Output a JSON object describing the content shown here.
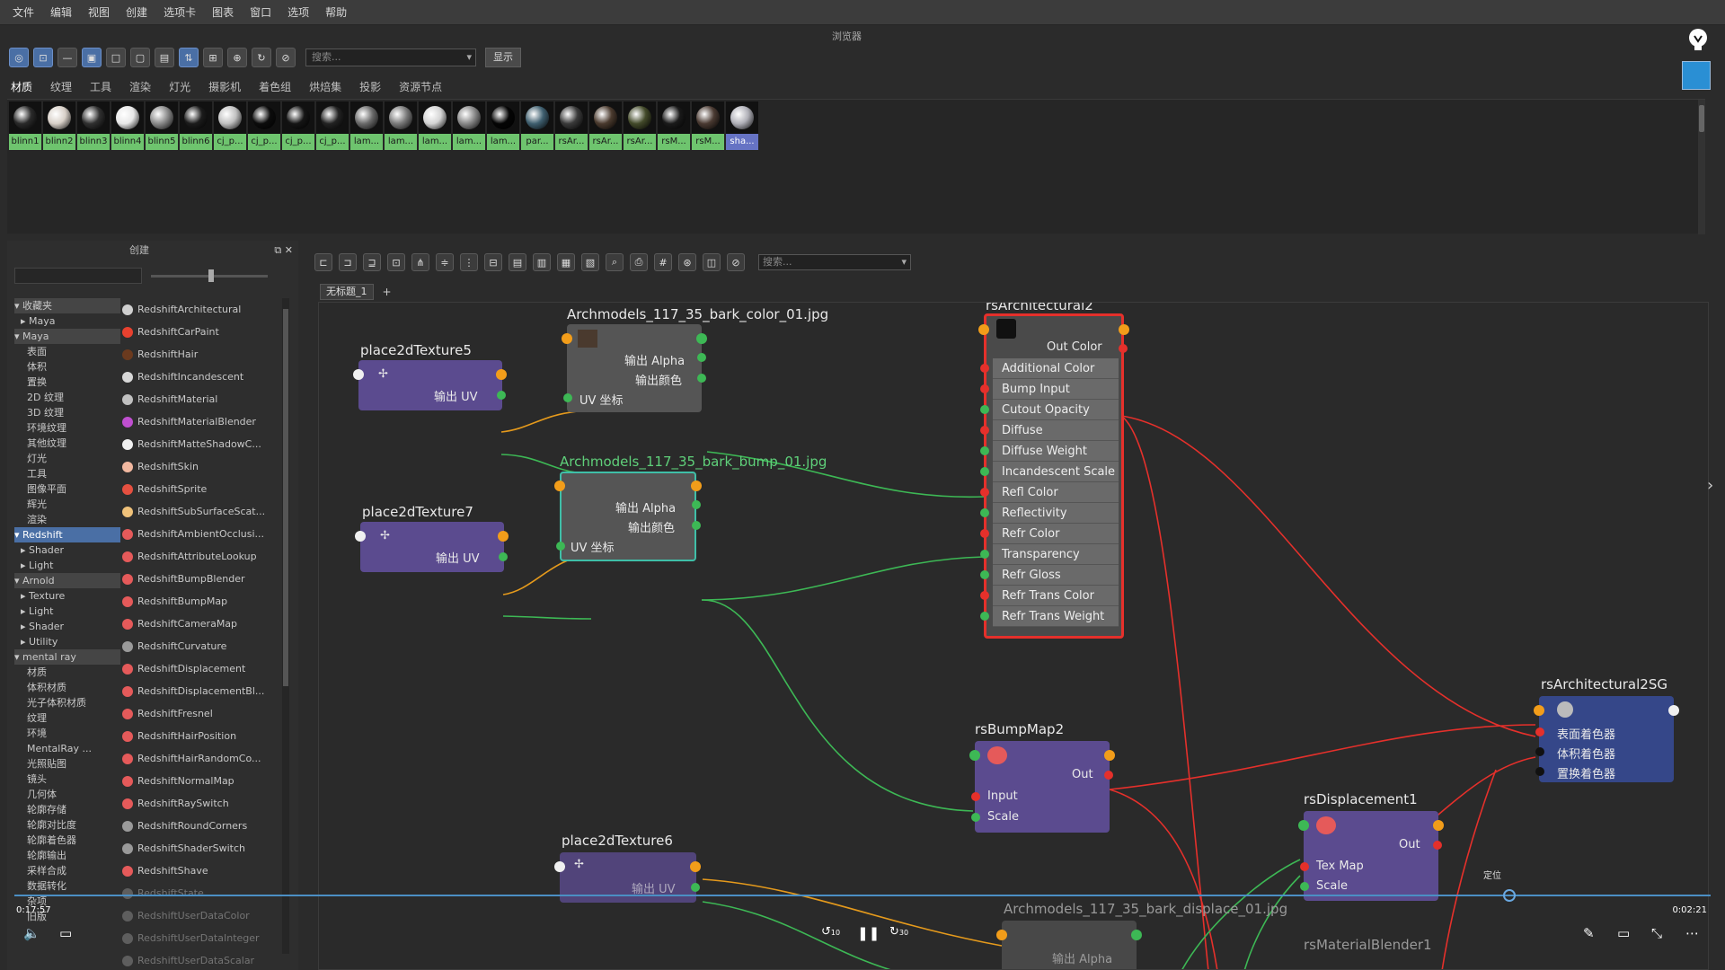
{
  "menu": [
    "文件",
    "编辑",
    "视图",
    "创建",
    "选项卡",
    "图表",
    "窗口",
    "选项",
    "帮助"
  ],
  "panel_title": "浏览器",
  "toolbar": {
    "search_placeholder": "搜索...",
    "show_label": "显示"
  },
  "category_tabs": [
    "材质",
    "纹理",
    "工具",
    "渲染",
    "灯光",
    "摄影机",
    "着色组",
    "烘焙集",
    "投影",
    "资源节点"
  ],
  "swatches": [
    {
      "label": "blinn1",
      "tone": "#2a2a2a"
    },
    {
      "label": "blinn2",
      "tone": "#d8d0c8"
    },
    {
      "label": "blinn3",
      "tone": "#303030"
    },
    {
      "label": "blinn4",
      "tone": "#e8e8e8"
    },
    {
      "label": "blinn5",
      "tone": "#8a8a8a"
    },
    {
      "label": "blinn6",
      "tone": "#1c1c1c"
    },
    {
      "label": "cj_p...",
      "tone": "#c0c0c0"
    },
    {
      "label": "cj_p...",
      "tone": "#0c0c0c"
    },
    {
      "label": "cj_p...",
      "tone": "#151515"
    },
    {
      "label": "cj_p...",
      "tone": "#222222"
    },
    {
      "label": "lam...",
      "tone": "#6a6a6a"
    },
    {
      "label": "lam...",
      "tone": "#7a7a7a"
    },
    {
      "label": "lam...",
      "tone": "#d4d4d4"
    },
    {
      "label": "lam...",
      "tone": "#888888"
    },
    {
      "label": "lam...",
      "tone": "#050505"
    },
    {
      "label": "par...",
      "tone": "#3f5f6f"
    },
    {
      "label": "rsAr...",
      "tone": "#3a3a3a"
    },
    {
      "label": "rsAr...",
      "tone": "#4a3a2e"
    },
    {
      "label": "rsAr...",
      "tone": "#434a2a"
    },
    {
      "label": "rsM...",
      "tone": "#1a1a1a"
    },
    {
      "label": "rsM...",
      "tone": "#4a3a32"
    },
    {
      "label": "sha...",
      "tone": "#b0b0b8"
    }
  ],
  "create_panel": {
    "title": "创建",
    "tree": [
      {
        "label": "▾ 收藏夹",
        "type": "head"
      },
      {
        "label": "  ▸ Maya",
        "type": "item"
      },
      {
        "label": "▾ Maya",
        "type": "head"
      },
      {
        "label": "    表面",
        "type": "item"
      },
      {
        "label": "    体积",
        "type": "item"
      },
      {
        "label": "    置换",
        "type": "item"
      },
      {
        "label": "    2D 纹理",
        "type": "item"
      },
      {
        "label": "    3D 纹理",
        "type": "item"
      },
      {
        "label": "    环境纹理",
        "type": "item"
      },
      {
        "label": "    其他纹理",
        "type": "item"
      },
      {
        "label": "    灯光",
        "type": "item"
      },
      {
        "label": "    工具",
        "type": "item"
      },
      {
        "label": "    图像平面",
        "type": "item"
      },
      {
        "label": "    辉光",
        "type": "item"
      },
      {
        "label": "    渲染",
        "type": "item"
      },
      {
        "label": "▾ Redshift",
        "type": "hl"
      },
      {
        "label": "  ▸ Shader",
        "type": "item"
      },
      {
        "label": "  ▸ Light",
        "type": "item"
      },
      {
        "label": "▾ Arnold",
        "type": "head"
      },
      {
        "label": "  ▸ Texture",
        "type": "item"
      },
      {
        "label": "  ▸ Light",
        "type": "item"
      },
      {
        "label": "  ▸ Shader",
        "type": "item"
      },
      {
        "label": "  ▸ Utility",
        "type": "item"
      },
      {
        "label": "▾ mental ray",
        "type": "head"
      },
      {
        "label": "    材质",
        "type": "item"
      },
      {
        "label": "    体积材质",
        "type": "item"
      },
      {
        "label": "    光子体积材质",
        "type": "item"
      },
      {
        "label": "    纹理",
        "type": "item"
      },
      {
        "label": "    环境",
        "type": "item"
      },
      {
        "label": "    MentalRay ...",
        "type": "item"
      },
      {
        "label": "    光照贴图",
        "type": "item"
      },
      {
        "label": "    镜头",
        "type": "item"
      },
      {
        "label": "    几何体",
        "type": "item"
      },
      {
        "label": "    轮廓存储",
        "type": "item"
      },
      {
        "label": "    轮廓对比度",
        "type": "item"
      },
      {
        "label": "    轮廓着色器",
        "type": "item"
      },
      {
        "label": "    轮廓输出",
        "type": "item"
      },
      {
        "label": "    采样合成",
        "type": "item"
      },
      {
        "label": "    数据转化",
        "type": "item"
      },
      {
        "label": "    杂项",
        "type": "item"
      },
      {
        "label": "    旧版",
        "type": "item"
      }
    ],
    "nodes": [
      {
        "label": "RedshiftArchitectural",
        "color": "#cfcfcf"
      },
      {
        "label": "RedshiftCarPaint",
        "color": "#e8412f"
      },
      {
        "label": "RedshiftHair",
        "color": "#6b3a1e"
      },
      {
        "label": "RedshiftIncandescent",
        "color": "#d8d8d8"
      },
      {
        "label": "RedshiftMaterial",
        "color": "#c0c0c0"
      },
      {
        "label": "RedshiftMaterialBlender",
        "color": "#c04fd0"
      },
      {
        "label": "RedshiftMatteShadowC...",
        "color": "#f0f0f0"
      },
      {
        "label": "RedshiftSkin",
        "color": "#f2b8a0"
      },
      {
        "label": "RedshiftSprite",
        "color": "#e55040"
      },
      {
        "label": "RedshiftSubSurfaceScat...",
        "color": "#f0c27a"
      },
      {
        "label": "RedshiftAmbientOcclusi...",
        "color": "#e55a5a"
      },
      {
        "label": "RedshiftAttributeLookup",
        "color": "#e55a5a"
      },
      {
        "label": "RedshiftBumpBlender",
        "color": "#e55a5a"
      },
      {
        "label": "RedshiftBumpMap",
        "color": "#e55a5a"
      },
      {
        "label": "RedshiftCameraMap",
        "color": "#e55a5a"
      },
      {
        "label": "RedshiftCurvature",
        "color": "#9a9a9a"
      },
      {
        "label": "RedshiftDisplacement",
        "color": "#e55a5a"
      },
      {
        "label": "RedshiftDisplacementBl...",
        "color": "#e55a5a"
      },
      {
        "label": "RedshiftFresnel",
        "color": "#e55a5a"
      },
      {
        "label": "RedshiftHairPosition",
        "color": "#e55a5a"
      },
      {
        "label": "RedshiftHairRandomCo...",
        "color": "#e55a5a"
      },
      {
        "label": "RedshiftNormalMap",
        "color": "#e55a5a"
      },
      {
        "label": "RedshiftRaySwitch",
        "color": "#e55a5a"
      },
      {
        "label": "RedshiftRoundCorners",
        "color": "#9a9a9a"
      },
      {
        "label": "RedshiftShaderSwitch",
        "color": "#9a9a9a"
      },
      {
        "label": "RedshiftShave",
        "color": "#e55a5a"
      },
      {
        "label": "RedshiftState",
        "color": "#9a9a9a"
      },
      {
        "label": "RedshiftUserDataColor",
        "color": "#9a9a9a"
      },
      {
        "label": "RedshiftUserDataInteger",
        "color": "#9a9a9a"
      },
      {
        "label": "RedshiftUserDataScalar",
        "color": "#9a9a9a"
      }
    ]
  },
  "node_editor": {
    "search_placeholder": "搜索...",
    "tab": "无标题_1",
    "add_tab": "+",
    "nodes": {
      "place2d5": {
        "title": "place2dTexture5",
        "out": "输出 UV"
      },
      "place2d7": {
        "title": "place2dTexture7",
        "out": "输出 UV"
      },
      "place2d6": {
        "title": "place2dTexture6",
        "out": "输出 UV"
      },
      "bark_color": {
        "title": "Archmodels_117_35_bark_color_01.jpg",
        "alpha": "输出 Alpha",
        "color": "输出颜色",
        "uv": "UV 坐标"
      },
      "bark_bump": {
        "title": "Archmodels_117_35_bark_bump_01.jpg",
        "alpha": "输出 Alpha",
        "color": "输出颜色",
        "uv": "UV 坐标"
      },
      "bark_disp": {
        "title": "Archmodels_117_35_bark_displace_01.jpg",
        "alpha": "输出 Alpha"
      },
      "arch2": {
        "title": "rsArchitectural2",
        "out": "Out Color",
        "inputs": [
          "Additional Color",
          "Bump Input",
          "Cutout Opacity",
          "Diffuse",
          "Diffuse Weight",
          "Incandescent Scale",
          "Refl Color",
          "Reflectivity",
          "Refr Color",
          "Transparency",
          "Refr Gloss",
          "Refr Trans Color",
          "Refr Trans Weight"
        ]
      },
      "bump2": {
        "title": "rsBumpMap2",
        "out": "Out",
        "in1": "Input",
        "in2": "Scale"
      },
      "disp1": {
        "title": "rsDisplacement1",
        "out": "Out",
        "in1": "Tex Map",
        "in2": "Scale"
      },
      "sg": {
        "title": "rsArchitectural2SG",
        "rows": [
          "表面着色器",
          "体积着色器",
          "置换着色器"
        ]
      },
      "blender": {
        "title": "rsMaterialBlender1"
      }
    }
  },
  "video": {
    "elapsed": "0:17:57",
    "total": "0:02:21",
    "tooltip": "定位",
    "skip_back": "10",
    "skip_fwd": "30"
  }
}
